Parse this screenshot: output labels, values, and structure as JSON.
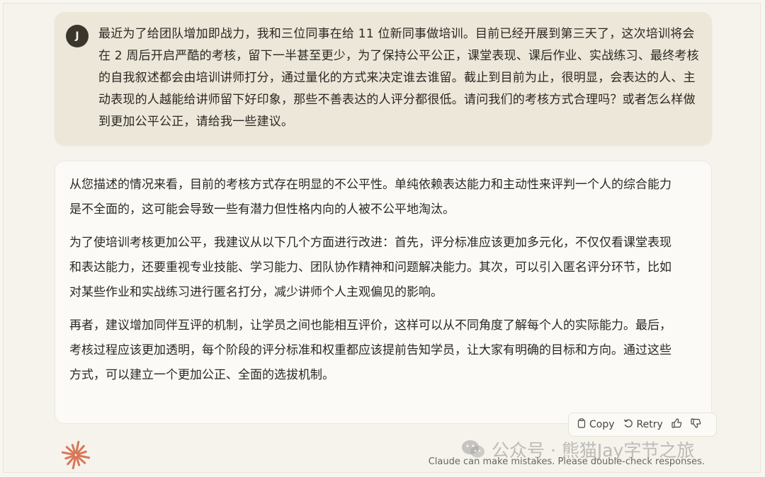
{
  "user": {
    "avatar_initial": "J",
    "message": "最近为了给团队增加即战力，我和三位同事在给 11 位新同事做培训。目前已经开展到第三天了，这次培训将会在 2 周后开启严酷的考核，留下一半甚至更少，为了保持公平公正，课堂表现、课后作业、实战练习、最终考核的自我叙述都会由培训讲师打分，通过量化的方式来决定谁去谁留。截止到目前为止，很明显，会表达的人、主动表现的人越能给讲师留下好印象，那些不善表达的人评分都很低。请问我们的考核方式合理吗？或者怎么样做到更加公平公正，请给我一些建议。"
  },
  "assistant": {
    "paragraphs": [
      "从您描述的情况来看，目前的考核方式存在明显的不公平性。单纯依赖表达能力和主动性来评判一个人的综合能力是不全面的，这可能会导致一些有潜力但性格内向的人被不公平地淘汰。",
      "为了使培训考核更加公平，我建议从以下几个方面进行改进：首先，评分标准应该更加多元化，不仅仅看课堂表现和表达能力，还要重视专业技能、学习能力、团队协作精神和问题解决能力。其次，可以引入匿名评分环节，比如对某些作业和实战练习进行匿名打分，减少讲师个人主观偏见的影响。",
      "再者，建议增加同伴互评的机制，让学员之间也能相互评价，这样可以从不同角度了解每个人的实际能力。最后，考核过程应该更加透明，每个阶段的评分标准和权重都应该提前告知学员，让大家有明确的目标和方向。通过这些方式，可以建立一个更加公正、全面的选拔机制。"
    ]
  },
  "actions": {
    "copy_label": "Copy",
    "retry_label": "Retry"
  },
  "footer": {
    "disclaimer": "Claude can make mistakes. Please double-check responses."
  },
  "watermark": {
    "text": "公众号 · 熊猫Jay字节之旅"
  },
  "colors": {
    "user_bubble": "#ece7d9",
    "assistant_bubble": "#fbfaf6",
    "brand_orange": "#d97757",
    "avatar_bg": "#3a362e"
  },
  "icons": {
    "copy": "clipboard-icon",
    "retry": "retry-icon",
    "thumbs_up": "thumbs-up-icon",
    "thumbs_down": "thumbs-down-icon",
    "logo": "claude-asterisk-logo"
  }
}
